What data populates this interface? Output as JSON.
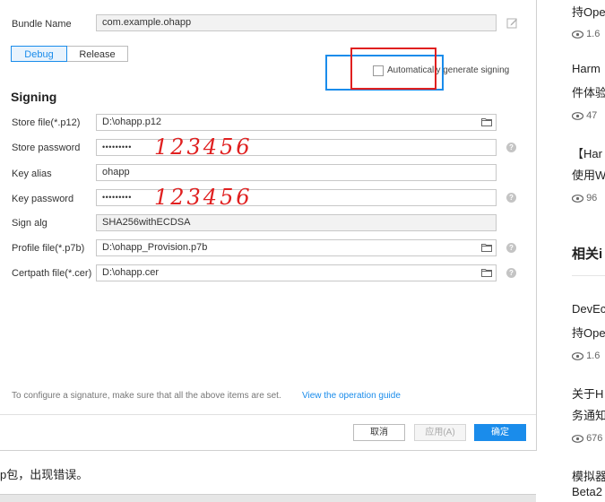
{
  "bundle": {
    "label": "Bundle Name",
    "value": "com.example.ohapp"
  },
  "tabs": [
    {
      "label": "Debug"
    },
    {
      "label": "Release"
    }
  ],
  "auto_sign_label": "Automatically generate signing",
  "signing_heading": "Signing",
  "fields": {
    "store_file": {
      "label": "Store file(*.p12)",
      "value": "D:\\ohapp.p12"
    },
    "store_password": {
      "label": "Store password",
      "value": "•••••••••"
    },
    "key_alias": {
      "label": "Key alias",
      "value": "ohapp"
    },
    "key_password": {
      "label": "Key password",
      "value": "•••••••••"
    },
    "sign_alg": {
      "label": "Sign alg",
      "value": "SHA256withECDSA"
    },
    "profile_file": {
      "label": "Profile file(*.p7b)",
      "value": "D:\\ohapp_Provision.p7b"
    },
    "certpath_file": {
      "label": "Certpath file(*.cer)",
      "value": "D:\\ohapp.cer"
    }
  },
  "annotations": {
    "store_password_note": "123456",
    "key_password_note": "123456"
  },
  "hint": {
    "text": "To configure a signature, make sure that all the above items are set.",
    "link": "View the operation guide"
  },
  "buttons": {
    "cancel": "取消",
    "apply": "应用(A)",
    "ok": "确定"
  },
  "bottom_caption": "p包，出现错误。",
  "sidebar": {
    "items": [
      {
        "line1": "持Ope",
        "views": "1.6"
      },
      {
        "line1": "Harm",
        "line2": "件体验",
        "views": "47"
      },
      {
        "line1": "【Har",
        "line2": "使用W",
        "views": "96"
      }
    ],
    "section_heading": "相关i",
    "items2": [
      {
        "line1": "DevEc",
        "line2": "持Ope",
        "views": "1.6"
      },
      {
        "line1": "关于H",
        "line2": "务通知",
        "views": "676"
      },
      {
        "line1": "模拟器",
        "line2": "Beta2"
      }
    ]
  },
  "colors": {
    "accent": "#1a8ceb",
    "annotation_red": "#e02020",
    "highlight_red": "#e02020",
    "highlight_blue": "#1a8ceb"
  }
}
